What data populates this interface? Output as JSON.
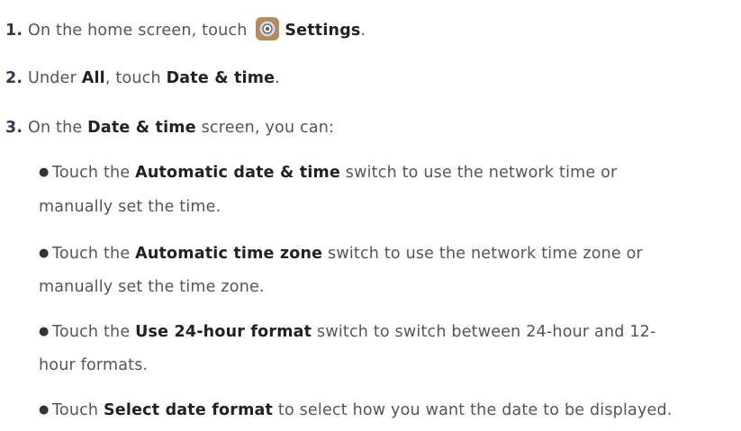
{
  "steps": [
    {
      "number": "1.",
      "pre": "On the home screen, touch",
      "bold": "Settings",
      "post": "."
    },
    {
      "number": "2.",
      "pre": "Under ",
      "bold1": "All",
      "mid": ", touch ",
      "bold2": "Date & time",
      "post": "."
    },
    {
      "number": "3.",
      "pre": "On the ",
      "bold": "Date & time",
      "post": " screen, you can:"
    }
  ],
  "bullets": [
    {
      "pre": "Touch the ",
      "bold": "Automatic date & time",
      "post": " switch to use the network time or",
      "cont": "manually set the time."
    },
    {
      "pre": "Touch the ",
      "bold": "Automatic time zone",
      "post": " switch to use the network time zone or",
      "cont": "manually set the time zone."
    },
    {
      "pre": "Touch the ",
      "bold": "Use 24-hour format",
      "post": " switch to switch between 24-hour and 12-",
      "cont": "hour formats."
    },
    {
      "pre": "Touch ",
      "bold": "Select date format",
      "post": " to select how you want the date to be displayed."
    }
  ],
  "icons": {
    "settings": "settings-gear-icon",
    "bullet": "bullet-dot"
  }
}
